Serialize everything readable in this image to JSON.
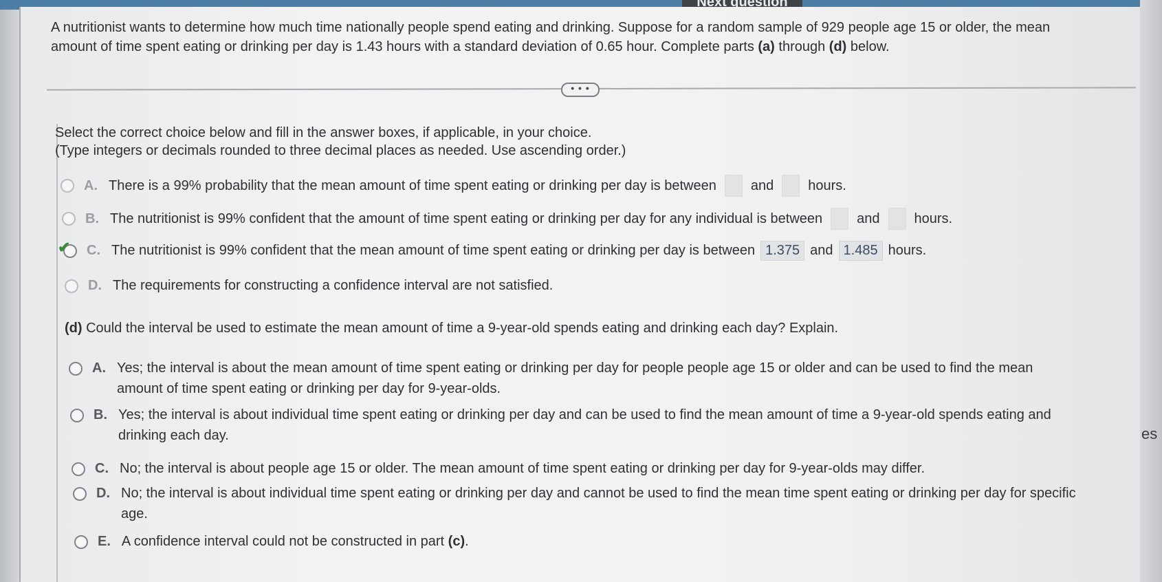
{
  "header": {
    "next_question": "Next question"
  },
  "problem": {
    "text_line1": "A nutritionist wants to determine how much time nationally people spend eating and drinking. Suppose for a random sample of 929 people age 15 or older, the mean",
    "text_line2_pre": "amount of time spent eating or drinking per day is 1.43 hours with a standard deviation of 0.65 hour. Complete parts ",
    "part_a": "(a)",
    "through": " through ",
    "part_d": "(d)",
    "text_line2_post": " below."
  },
  "more_button": "• • •",
  "instructions": {
    "line1": "Select the correct choice below and fill in the answer boxes, if applicable, in your choice.",
    "line2": "(Type integers or decimals rounded to three decimal places as needed. Use ascending order.)"
  },
  "part_c": {
    "options": [
      {
        "letter": "A.",
        "text": "There is a 99% probability that the mean amount of time spent eating or drinking per day is between",
        "and": "and",
        "suffix": "hours."
      },
      {
        "letter": "B.",
        "text": "The nutritionist is 99% confident that the amount of time spent eating or drinking per day for any individual is between",
        "and": "and",
        "suffix": "hours."
      },
      {
        "letter": "C.",
        "text": "The nutritionist is 99% confident that the mean amount of time spent eating or drinking per day is between",
        "value1": "1.375",
        "and": "and",
        "value2": "1.485",
        "suffix": "hours.",
        "selected": true
      },
      {
        "letter": "D.",
        "text": "The requirements for constructing a confidence interval are not satisfied."
      }
    ]
  },
  "part_d": {
    "label": "(d)",
    "question": "Could the interval be used to estimate the mean amount of time a 9-year-old spends eating and drinking each day? Explain.",
    "options": [
      {
        "letter": "A.",
        "line1": "Yes; the interval is about the mean amount of time spent eating or drinking per day for people people age 15 or older and can be used to find the mean",
        "line2": "amount of time spent eating or drinking per day for 9-year-olds."
      },
      {
        "letter": "B.",
        "line1": "Yes; the interval is about individual time spent eating or drinking per day and can be used to find the mean amount of time a 9-year-old spends eating and",
        "line2": "drinking each day."
      },
      {
        "letter": "C.",
        "line1": "No; the interval is about people age 15 or older. The mean amount of time spent eating or drinking per day for 9-year-olds may differ."
      },
      {
        "letter": "D.",
        "line1": "No; the interval is about individual time spent eating or drinking per day and cannot be used to find the mean time spent eating or drinking per day for specific",
        "line2": "age."
      },
      {
        "letter": "E.",
        "line1_pre": "A confidence interval could not be constructed in part ",
        "part": "(c)",
        "line1_post": "."
      }
    ]
  },
  "edge_text": "es"
}
